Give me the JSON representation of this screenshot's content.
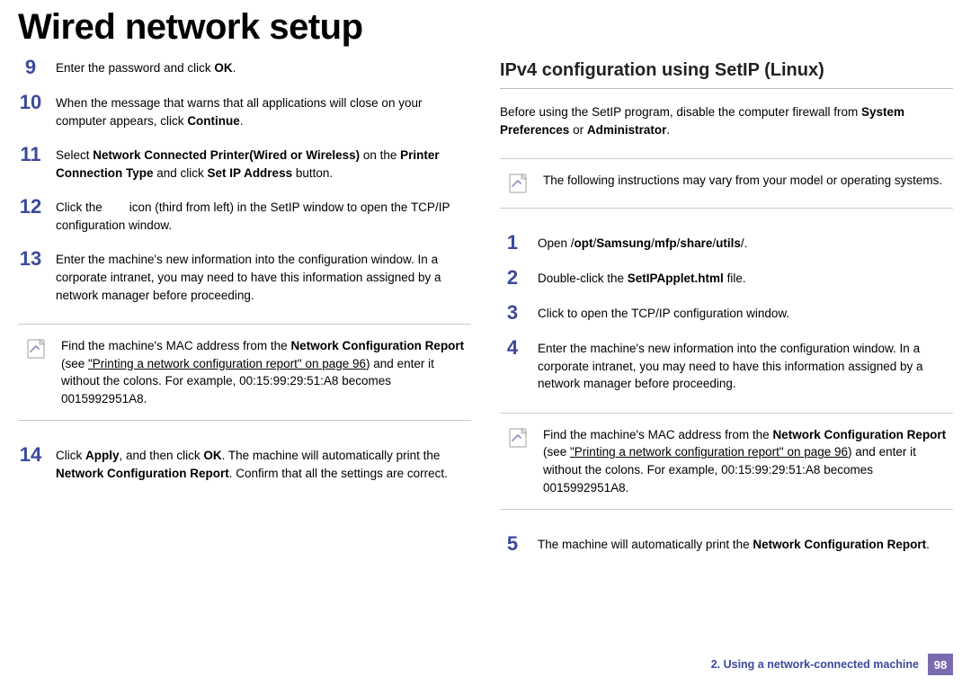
{
  "page_title": "Wired network setup",
  "left_steps": [
    {
      "num": "9",
      "html": "Enter the password and click <b>OK</b>."
    },
    {
      "num": "10",
      "html": "When the message that warns that all applications will close on your computer appears, click <b>Continue</b>."
    },
    {
      "num": "11",
      "html": "Select <b>Network Connected Printer(Wired or Wireless)</b> on the <b>Printer Connection Type</b> and click <b>Set IP Address</b> button."
    },
    {
      "num": "12",
      "html": "Click the &nbsp;&nbsp;&nbsp;&nbsp;&nbsp;&nbsp; icon (third from left) in the SetIP window to open the TCP/IP configuration window."
    },
    {
      "num": "13",
      "html": "Enter the machine's new information into the configuration window. In a corporate intranet, you may need to have this information assigned by a network manager before proceeding."
    }
  ],
  "left_note": "Find the machine's MAC address from the <b>Network Configuration Report</b> (see <span class=\"u\">\"Printing a network configuration report\" on page 96</span>) and enter it without the colons. For example, 00:15:99:29:51:A8 becomes 0015992951A8.",
  "left_steps_after": [
    {
      "num": "14",
      "html": "Click <b>Apply</b>, and then click <b>OK</b>. The machine will automatically print the <b>Network Configuration Report</b>. Confirm that all the settings are correct."
    }
  ],
  "right_heading": "IPv4 configuration using SetIP (Linux)",
  "right_intro": "Before using the SetIP program, disable the computer firewall from <b>System Preferences</b> or <b>Administrator</b>.",
  "right_top_note": "The following instructions may vary from your model or operating systems.",
  "right_steps": [
    {
      "num": "1",
      "html": "Open /<b>opt</b>/<b>Samsung</b>/<b>mfp</b>/<b>share</b>/<b>utils</b>/."
    },
    {
      "num": "2",
      "html": "Double-click the <b>SetIPApplet.html</b> file."
    },
    {
      "num": "3",
      "html": "Click to open the TCP/IP configuration window."
    },
    {
      "num": "4",
      "html": "Enter the machine's new information into the configuration window. In a corporate intranet, you may need to have this information assigned by a network manager before proceeding."
    }
  ],
  "right_note": "Find the machine's MAC address from the <b>Network Configuration Report</b> (see <span class=\"u\">\"Printing a network configuration report\" on page 96</span>) and enter it without the colons. For example, 00:15:99:29:51:A8 becomes 0015992951A8.",
  "right_steps_after": [
    {
      "num": "5",
      "html": "The machine will automatically print the <b>Network Configuration Report</b>."
    }
  ],
  "footer_chapter": "2.  Using a network-connected machine",
  "footer_page": "98"
}
